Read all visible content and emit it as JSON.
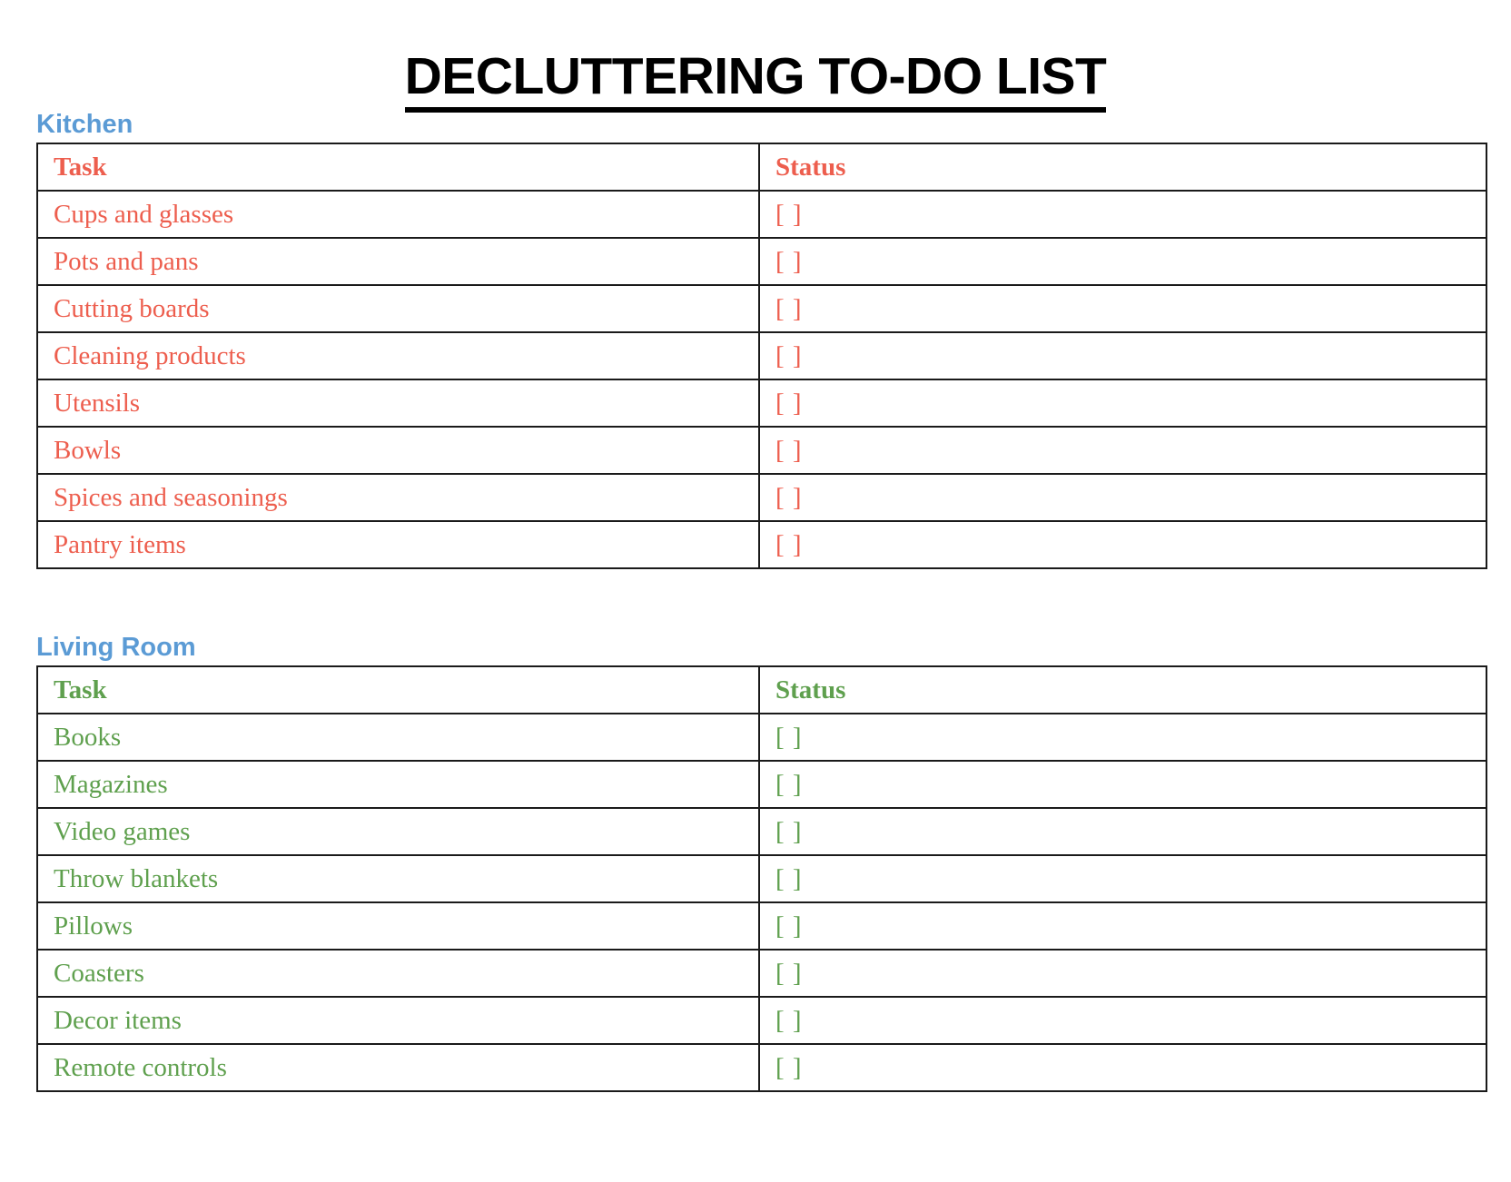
{
  "document": {
    "title": "DECLUTTERING TO-DO LIST"
  },
  "colors": {
    "heading_blue": "#5B9BD5",
    "kitchen_text": "#ED5E4E",
    "living_room_text": "#5FA04E",
    "border": "#1a1a1a",
    "title_text": "#000000",
    "page_background": "#ffffff"
  },
  "sections": [
    {
      "id": "kitchen",
      "heading": "Kitchen",
      "theme": "red",
      "columns": [
        "Task",
        "Status"
      ],
      "rows": [
        {
          "task": "Cups and glasses",
          "status": "[ ]"
        },
        {
          "task": "Pots and pans",
          "status": "[ ]"
        },
        {
          "task": "Cutting boards",
          "status": "[ ]"
        },
        {
          "task": "Cleaning products",
          "status": "[ ]"
        },
        {
          "task": "Utensils",
          "status": "[ ]"
        },
        {
          "task": "Bowls",
          "status": "[ ]"
        },
        {
          "task": "Spices and seasonings",
          "status": "[ ]"
        },
        {
          "task": "Pantry items",
          "status": "[ ]"
        }
      ]
    },
    {
      "id": "living_room",
      "heading": "Living Room",
      "theme": "green",
      "columns": [
        "Task",
        "Status"
      ],
      "rows": [
        {
          "task": "Books",
          "status": "[ ]"
        },
        {
          "task": "Magazines",
          "status": "[ ]"
        },
        {
          "task": "Video games",
          "status": "[ ]"
        },
        {
          "task": "Throw blankets",
          "status": "[ ]"
        },
        {
          "task": "Pillows",
          "status": "[ ]"
        },
        {
          "task": "Coasters",
          "status": "[ ]"
        },
        {
          "task": "Decor items",
          "status": "[ ]"
        },
        {
          "task": "Remote controls",
          "status": "[ ]"
        }
      ]
    }
  ]
}
